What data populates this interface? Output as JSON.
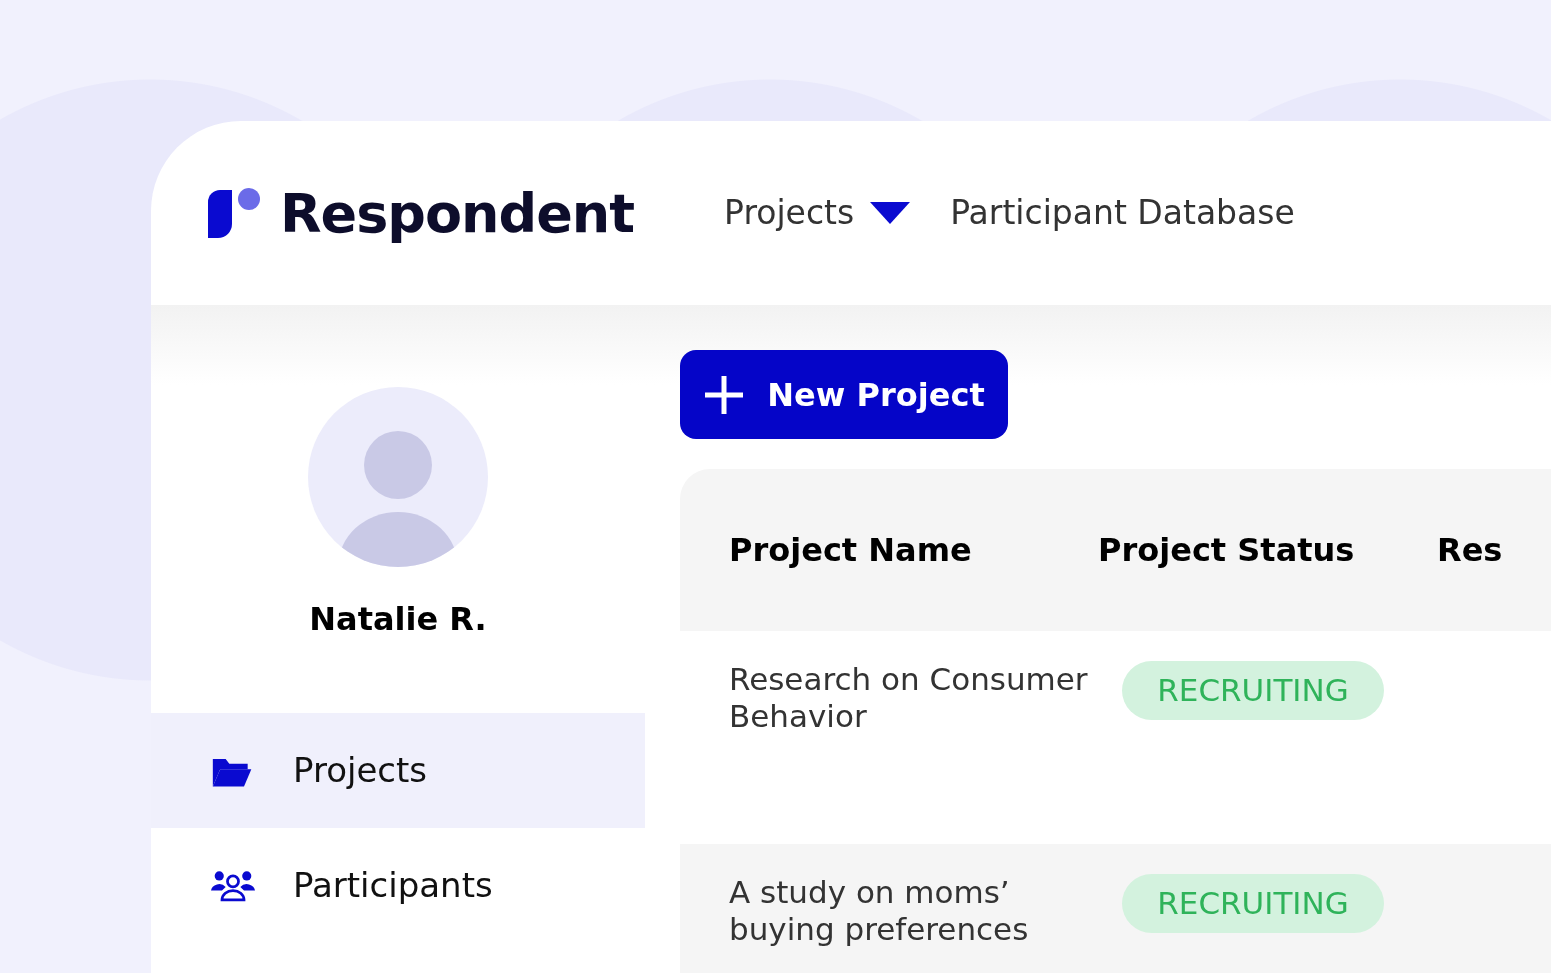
{
  "brand": {
    "name": "Respondent"
  },
  "top_nav": [
    {
      "label": "Projects",
      "has_dropdown": true
    },
    {
      "label": "Participant Database",
      "has_dropdown": false
    }
  ],
  "user": {
    "name": "Natalie R."
  },
  "sidebar": {
    "items": [
      {
        "label": "Projects",
        "kind": "folder",
        "selected": true
      },
      {
        "label": "Participants",
        "kind": "people",
        "selected": false
      }
    ]
  },
  "new_project_button": {
    "label": "New Project"
  },
  "table": {
    "columns": [
      "Project Name",
      "Project Status",
      "Res"
    ],
    "rows": [
      {
        "name": "Research on Consumer Behavior",
        "status": "RECRUITING"
      },
      {
        "name": "A study on moms’ buying preferences",
        "status": "RECRUITING"
      }
    ]
  }
}
